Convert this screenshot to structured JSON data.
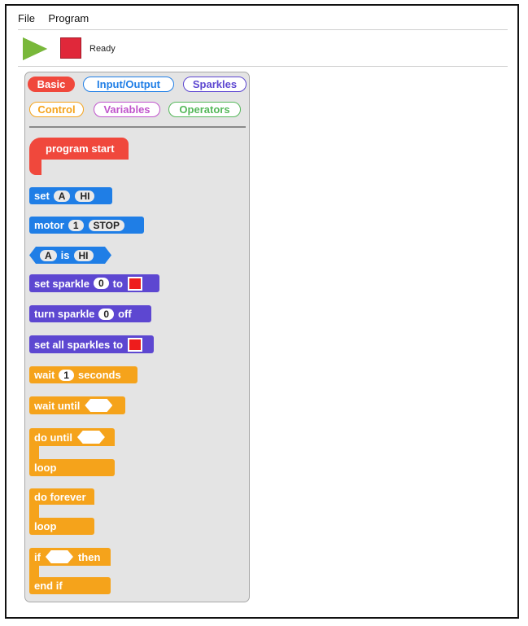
{
  "menu": {
    "file": "File",
    "program": "Program"
  },
  "toolbar": {
    "status": "Ready"
  },
  "categories": {
    "basic": "Basic",
    "io": "Input/Output",
    "sparkles": "Sparkles",
    "control": "Control",
    "variables": "Variables",
    "operators": "Operators"
  },
  "colors": {
    "basic": "#f0483c",
    "io": "#1f7ee6",
    "sparkles": "#5d47d1",
    "control": "#f5a31b",
    "variables": "#c054cc",
    "operators": "#55b85a"
  },
  "blocks": {
    "program_start": "program start",
    "set": {
      "label": "set",
      "var": "A",
      "value": "HI"
    },
    "motor": {
      "label": "motor",
      "num": "1",
      "state": "STOP"
    },
    "is": {
      "var": "A",
      "label": "is",
      "value": "HI"
    },
    "set_sparkle": {
      "label": "set sparkle",
      "num": "0",
      "to": "to"
    },
    "turn_sparkle": {
      "label": "turn sparkle",
      "num": "0",
      "off": "off"
    },
    "set_all": {
      "label": "set all sparkles to"
    },
    "wait": {
      "label": "wait",
      "num": "1",
      "unit": "seconds"
    },
    "wait_until": {
      "label": "wait until"
    },
    "do_until": {
      "label": "do until",
      "loop": "loop"
    },
    "do_forever": {
      "label": "do forever",
      "loop": "loop"
    },
    "if_then": {
      "if": "if",
      "then": "then",
      "end": "end if"
    }
  }
}
